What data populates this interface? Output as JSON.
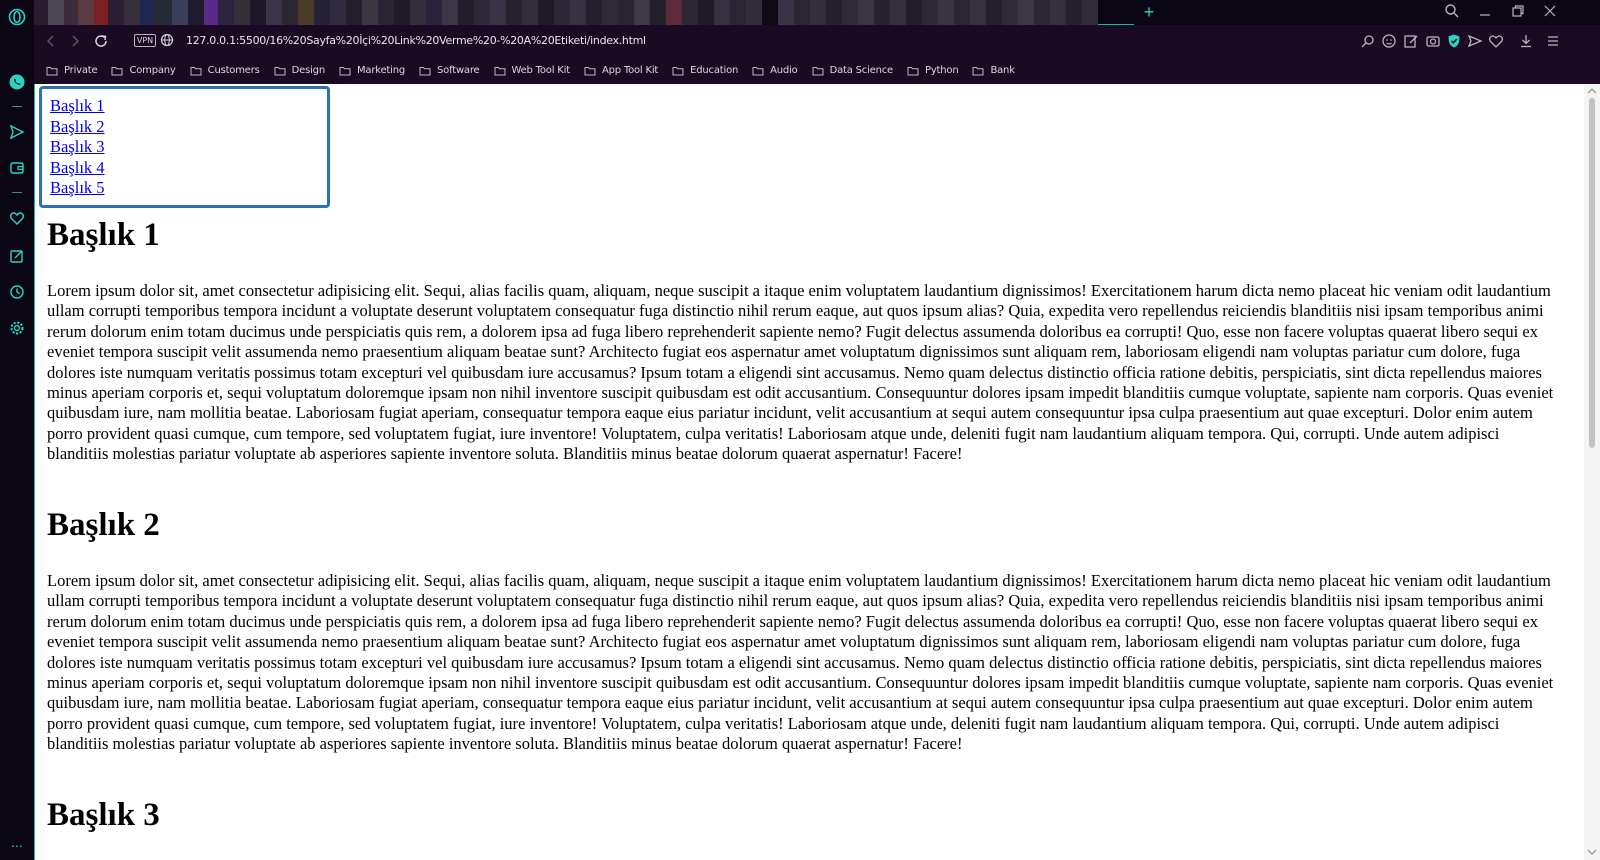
{
  "browser": {
    "address_bar": {
      "vpn_label": "VPN",
      "url": "127.0.0.1:5500/16%20Sayfa%20İçi%20Link%20Verme%20-%20A%20Etiketi/index.html"
    },
    "bookmarks": [
      {
        "label": "Private"
      },
      {
        "label": "Company"
      },
      {
        "label": "Customers"
      },
      {
        "label": "Design"
      },
      {
        "label": "Marketing"
      },
      {
        "label": "Software"
      },
      {
        "label": "Web Tool Kit"
      },
      {
        "label": "App Tool Kit"
      },
      {
        "label": "Education"
      },
      {
        "label": "Audio"
      },
      {
        "label": "Data Science"
      },
      {
        "label": "Python"
      },
      {
        "label": "Bank"
      }
    ],
    "sidebar_more_label": "...",
    "accent_color": "#1fb7a6"
  },
  "page": {
    "toc": [
      {
        "label": "Başlık 1"
      },
      {
        "label": "Başlık 2"
      },
      {
        "label": "Başlık 3"
      },
      {
        "label": "Başlık 4"
      },
      {
        "label": "Başlık 5"
      }
    ],
    "sections": [
      {
        "heading": "Başlık 1",
        "text": "Lorem ipsum dolor sit, amet consectetur adipisicing elit. Sequi, alias facilis quam, aliquam, neque suscipit a itaque enim voluptatem laudantium dignissimos! Exercitationem harum dicta nemo placeat hic veniam odit laudantium ullam corrupti temporibus tempora incidunt a voluptate deserunt voluptatem consequatur fuga distinctio nihil rerum eaque, aut quos ipsum alias? Quia, expedita vero repellendus reiciendis blanditiis nisi ipsam temporibus animi rerum dolorum enim totam ducimus unde perspiciatis quis rem, a dolorem ipsa ad fuga libero reprehenderit sapiente nemo? Fugit delectus assumenda doloribus ea corrupti! Quo, esse non facere voluptas quaerat libero sequi ex eveniet tempora suscipit velit assumenda nemo praesentium aliquam beatae sunt? Architecto fugiat eos aspernatur amet voluptatum dignissimos sunt aliquam rem, laboriosam eligendi nam voluptas pariatur cum dolore, fuga dolores iste numquam veritatis possimus totam excepturi vel quibusdam iure accusamus? Ipsum totam a eligendi sint accusamus. Nemo quam delectus distinctio officia ratione debitis, perspiciatis, sint dicta repellendus maiores minus aperiam corporis et, sequi voluptatum doloremque ipsam non nihil inventore suscipit quibusdam est odit accusantium. Consequuntur dolores ipsam impedit blanditiis cumque voluptate, sapiente nam corporis. Quas eveniet quibusdam iure, nam mollitia beatae. Laboriosam fugiat aperiam, consequatur tempora eaque eius pariatur incidunt, velit accusantium at sequi autem consequuntur ipsa culpa praesentium aut quae excepturi. Dolor enim autem porro provident quasi cumque, cum tempore, sed voluptatem fugiat, iure inventore! Voluptatem, culpa veritatis! Laboriosam atque unde, deleniti fugit nam laudantium aliquam tempora. Qui, corrupti. Unde autem adipisci blanditiis molestias pariatur voluptate ab asperiores sapiente inventore soluta. Blanditiis minus beatae dolorum quaerat aspernatur! Facere!"
      },
      {
        "heading": "Başlık 2",
        "text": "Lorem ipsum dolor sit, amet consectetur adipisicing elit. Sequi, alias facilis quam, aliquam, neque suscipit a itaque enim voluptatem laudantium dignissimos! Exercitationem harum dicta nemo placeat hic veniam odit laudantium ullam corrupti temporibus tempora incidunt a voluptate deserunt voluptatem consequatur fuga distinctio nihil rerum eaque, aut quos ipsum alias? Quia, expedita vero repellendus reiciendis blanditiis nisi ipsam temporibus animi rerum dolorum enim totam ducimus unde perspiciatis quis rem, a dolorem ipsa ad fuga libero reprehenderit sapiente nemo? Fugit delectus assumenda doloribus ea corrupti! Quo, esse non facere voluptas quaerat libero sequi ex eveniet tempora suscipit velit assumenda nemo praesentium aliquam beatae sunt? Architecto fugiat eos aspernatur amet voluptatum dignissimos sunt aliquam rem, laboriosam eligendi nam voluptas pariatur cum dolore, fuga dolores iste numquam veritatis possimus totam excepturi vel quibusdam iure accusamus? Ipsum totam a eligendi sint accusamus. Nemo quam delectus distinctio officia ratione debitis, perspiciatis, sint dicta repellendus maiores minus aperiam corporis et, sequi voluptatum doloremque ipsam non nihil inventore suscipit quibusdam est odit accusantium. Consequuntur dolores ipsam impedit blanditiis cumque voluptate, sapiente nam corporis. Quas eveniet quibusdam iure, nam mollitia beatae. Laboriosam fugiat aperiam, consequatur tempora eaque eius pariatur incidunt, velit accusantium at sequi autem consequuntur ipsa culpa praesentium aut quae excepturi. Dolor enim autem porro provident quasi cumque, cum tempore, sed voluptatem fugiat, iure inventore! Voluptatem, culpa veritatis! Laboriosam atque unde, deleniti fugit nam laudantium aliquam tempora. Qui, corrupti. Unde autem adipisci blanditiis molestias pariatur voluptate ab asperiores sapiente inventore soluta. Blanditiis minus beatae dolorum quaerat aspernatur! Facere!"
      },
      {
        "heading": "Başlık 3"
      }
    ]
  }
}
